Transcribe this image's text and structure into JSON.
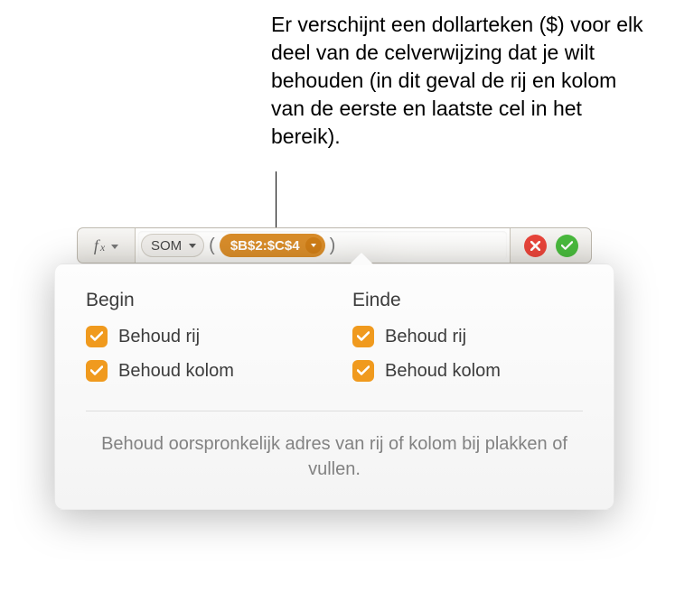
{
  "callout": "Er verschijnt een dollarteken ($) voor elk deel van de celverwijzing dat je wilt behouden (in dit geval de rij en kolom van de eerste en laatste cel in het bereik).",
  "formula_bar": {
    "fx_label": "f",
    "fx_sub": "x",
    "function_name": "SOM",
    "open_paren": "(",
    "reference": "$B$2:$C$4",
    "close_paren": ")"
  },
  "popover": {
    "begin": {
      "title": "Begin",
      "row": "Behoud rij",
      "col": "Behoud kolom"
    },
    "end": {
      "title": "Einde",
      "row": "Behoud rij",
      "col": "Behoud kolom"
    },
    "help_text": "Behoud oorspronkelijk adres van rij of kolom bij plakken of vullen."
  }
}
